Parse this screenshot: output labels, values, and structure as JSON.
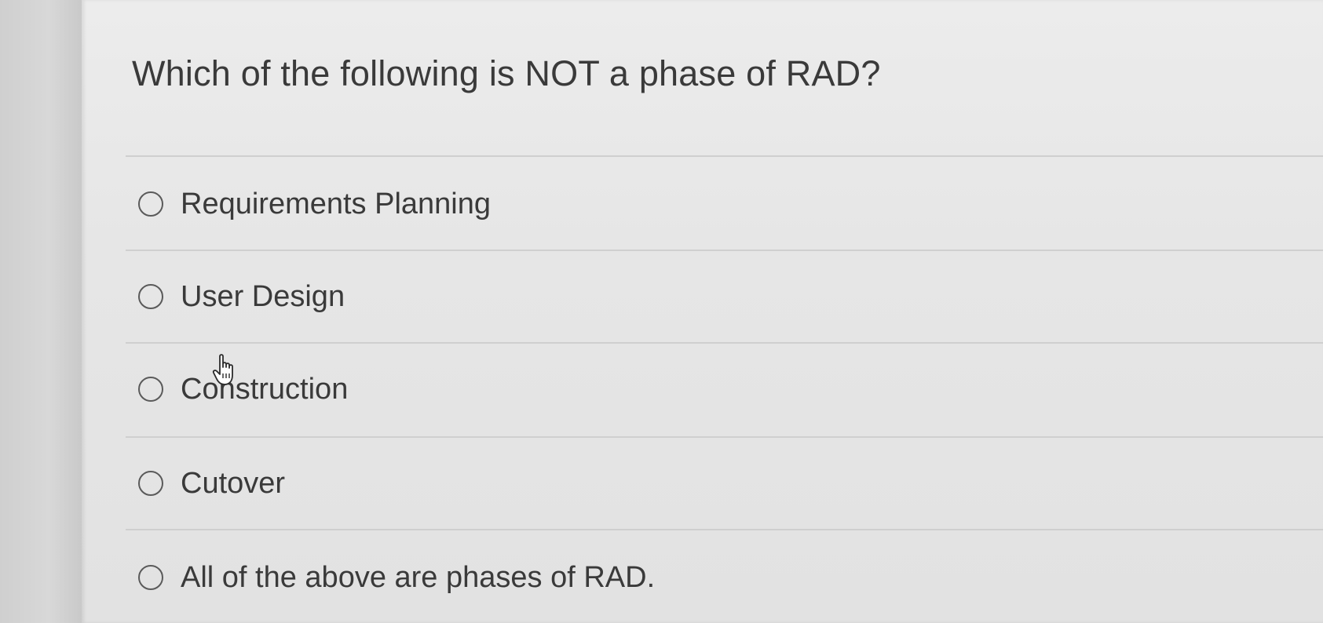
{
  "quiz": {
    "question": "Which of the following is NOT a phase of RAD?",
    "options": [
      {
        "label": "Requirements Planning",
        "selected": false
      },
      {
        "label": "User Design",
        "selected": false
      },
      {
        "label": "Construction",
        "selected": false
      },
      {
        "label": "Cutover",
        "selected": false
      },
      {
        "label": "All of the above are phases of RAD.",
        "selected": false
      }
    ]
  },
  "cursor": {
    "icon": "hand-pointer-icon"
  }
}
